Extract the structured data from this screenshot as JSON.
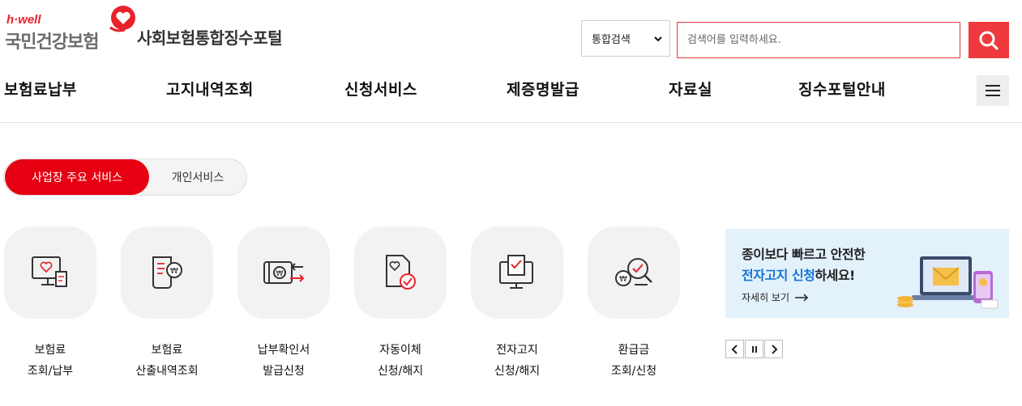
{
  "header": {
    "logo_small": "h·well",
    "logo_main": "국민건강보험",
    "portal_title": "사회보험통합징수포털",
    "search_scope": "통합검색",
    "search_placeholder": "검색어를 입력하세요."
  },
  "gnb": {
    "items": [
      "보험료납부",
      "고지내역조회",
      "신청서비스",
      "제증명발급",
      "자료실",
      "징수포털안내"
    ]
  },
  "tabs": {
    "active": "사업장 주요 서비스",
    "inactive": "개인서비스"
  },
  "services": [
    {
      "line1": "보험료",
      "line2": "조회/납부",
      "icon": "monitor-heart-receipt-icon"
    },
    {
      "line1": "보험료",
      "line2": "산출내역조회",
      "icon": "document-won-icon"
    },
    {
      "line1": "납부확인서",
      "line2": "발급신청",
      "icon": "card-won-arrows-icon"
    },
    {
      "line1": "자동이체",
      "line2": "신청/해지",
      "icon": "document-check-icon"
    },
    {
      "line1": "전자고지",
      "line2": "신청/해지",
      "icon": "monitor-check-icon"
    },
    {
      "line1": "환급금",
      "line2": "조회/신청",
      "icon": "magnifier-won-icon"
    }
  ],
  "banner": {
    "line1": "종이보다 빠르고 안전한",
    "line2_highlight": "전자고지 신청",
    "line2_rest": "하세요!",
    "more": "자세히 보기"
  },
  "colors": {
    "brand_red": "#e60012",
    "search_red": "#ee3a3d",
    "banner_bg": "#e3f1fb",
    "highlight_blue": "#1673d4",
    "tile_bg": "#f2f2f2"
  }
}
